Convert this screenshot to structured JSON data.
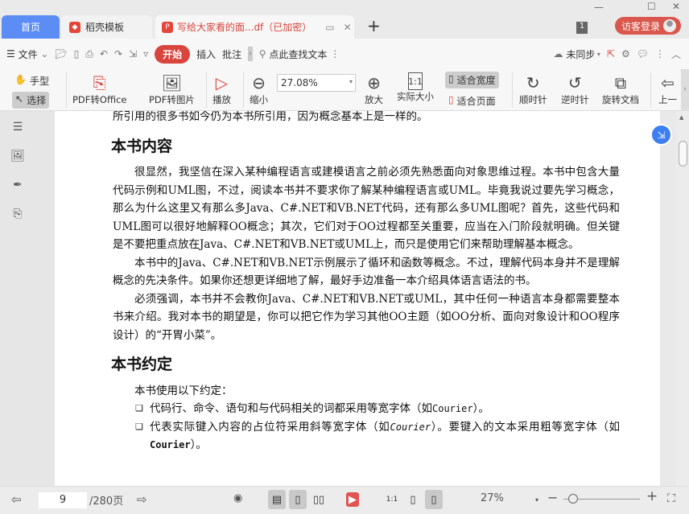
{
  "window": {
    "minimize": "—",
    "maximize": "☐",
    "close": "✕"
  },
  "tabs": [
    {
      "label": "首页"
    },
    {
      "label": "稻壳模板"
    },
    {
      "label": "写给大家看的面...df（已加密）"
    }
  ],
  "tab_new": "+",
  "window_count": "1",
  "login": "访客登录",
  "toolbar": {
    "menu": "文件",
    "start": "开始",
    "insert": "插入",
    "annotate": "批注",
    "search": "点此查找文本",
    "sync": "未同步"
  },
  "ribbon": {
    "hand": "手型",
    "select": "选择",
    "pdf_office": "PDF转Office",
    "pdf_image": "PDF转图片",
    "play": "播放",
    "zoom_out": "缩小",
    "zoom_value": "27.08%",
    "zoom_in": "放大",
    "actual": "实际大小",
    "fit_width": "适合宽度",
    "fit_page": "适合页面",
    "clockwise": "顺时针",
    "counter": "逆时针",
    "rotate_doc": "旋转文档",
    "prev": "上一"
  },
  "document": {
    "line0": "所引用的很多书如今仍为本书所引用，因为概念基本上是一样的。",
    "h1": "本书内容",
    "p1": "很显然，我坚信在深入某种编程语言或建模语言之前必须先熟悉面向对象思维过程。本书中包含大量代码示例和UML图，不过，阅读本书并不要求你了解某种编程语言或UML。毕竟我说过要先学习概念，那么为什么这里又有那么多Java、C#.NET和VB.NET代码，还有那么多UML图呢？首先，这些代码和UML图可以很好地解释OO概念；其次，它们对于OO过程都至关重要，应当在入门阶段就明确。但关键是不要把重点放在Java、C#.NET和VB.NET或UML上，而只是使用它们来帮助理解基本概念。",
    "p2": "本书中的Java、C#.NET和VB.NET示例展示了循环和函数等概念。不过，理解代码本身并不是理解概念的先决条件。如果你还想更详细地了解，最好手边准备一本介绍具体语言语法的书。",
    "p3": "必须强调，本书并不会教你Java、C#.NET和VB.NET或UML，其中任何一种语言本身都需要整本书来介绍。我对本书的期望是，你可以把它作为学习其他OO主题（如OO分析、面向对象设计和OO程序设计）的“开胃小菜”。",
    "h2": "本书约定",
    "p4": "本书使用以下约定：",
    "li1a": "代码行、命令、语句和与代码相关的词都采用等宽字体（如",
    "li1b": "Courier",
    "li1c": "）。",
    "li2a": "代表实际键入内容的占位符采用斜等宽字体（如",
    "li2b": "Courier",
    "li2c": "）。要键入的文本采用粗等宽字体（如",
    "li2d": "Courier",
    "li2e": "）。"
  },
  "status": {
    "page": "9",
    "total": "/280页",
    "zoom": "27%",
    "minus": "−",
    "plus": "+"
  }
}
